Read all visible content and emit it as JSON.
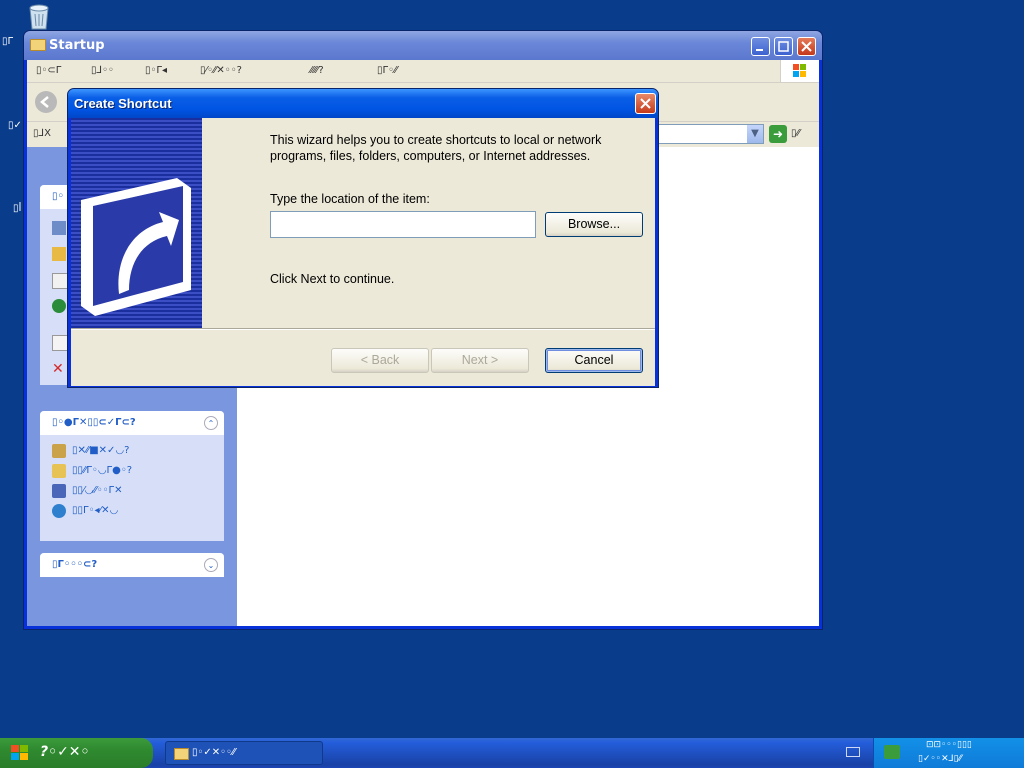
{
  "desktop": {
    "icons": [
      "▯Γ",
      "▯✓",
      "▯ꟾ"
    ]
  },
  "explorer": {
    "title": "Startup",
    "menus": [
      "▯◦⊂Γ",
      "▯⅃◦◦",
      "▯◦Γ◂",
      "▯⁄◦⁄⁄✕◦◦?",
      "⁄⁄⁄⁄⁄?",
      "▯Γ◦⁄⁄"
    ],
    "address_label": "▯⅃X",
    "go_label": "▯⁄⁄",
    "task_box1_title": "▯◦",
    "task_box2_title": "▯◦●Γ✕▯▯⊂✓Γ⊂?",
    "task_box2_items": [
      "▯✕⁄⁄■✕✓◡?",
      "▯▯⁄⁄Γ◦◡Γ●◦?",
      "▯▯⁄◡⁄⁄◦◦Γ✕",
      "▯▯Γ◦◂⁄✕◡"
    ],
    "task_box3_title": "▯Γ◦◦◦⊂?",
    "chevron_up": "⌃",
    "chevron_down": "⌄"
  },
  "dialog": {
    "title": "Create Shortcut",
    "intro": "This wizard helps you to create shortcuts to local or network programs, files, folders, computers, or Internet addresses.",
    "location_label": "Type the location of the item:",
    "location_value": "",
    "browse_label": "Browse...",
    "continue_text": "Click Next to continue.",
    "back_label": "< Back",
    "next_label": "Next >",
    "cancel_label": "Cancel"
  },
  "taskbar": {
    "start_label": "?◦✓✕◦",
    "task_label": "▯◦✓✕◦◦⁄⁄",
    "tray_line1": "⊡⊡◦◦◦▯▯▯",
    "tray_line2": "▯✓◦◦✕⅃▯⁄⁄"
  },
  "colors": {
    "desktop": "#0a3c8c",
    "title_active": "#0054e3",
    "dialog_face": "#ece9d8",
    "link": "#215dc6"
  }
}
